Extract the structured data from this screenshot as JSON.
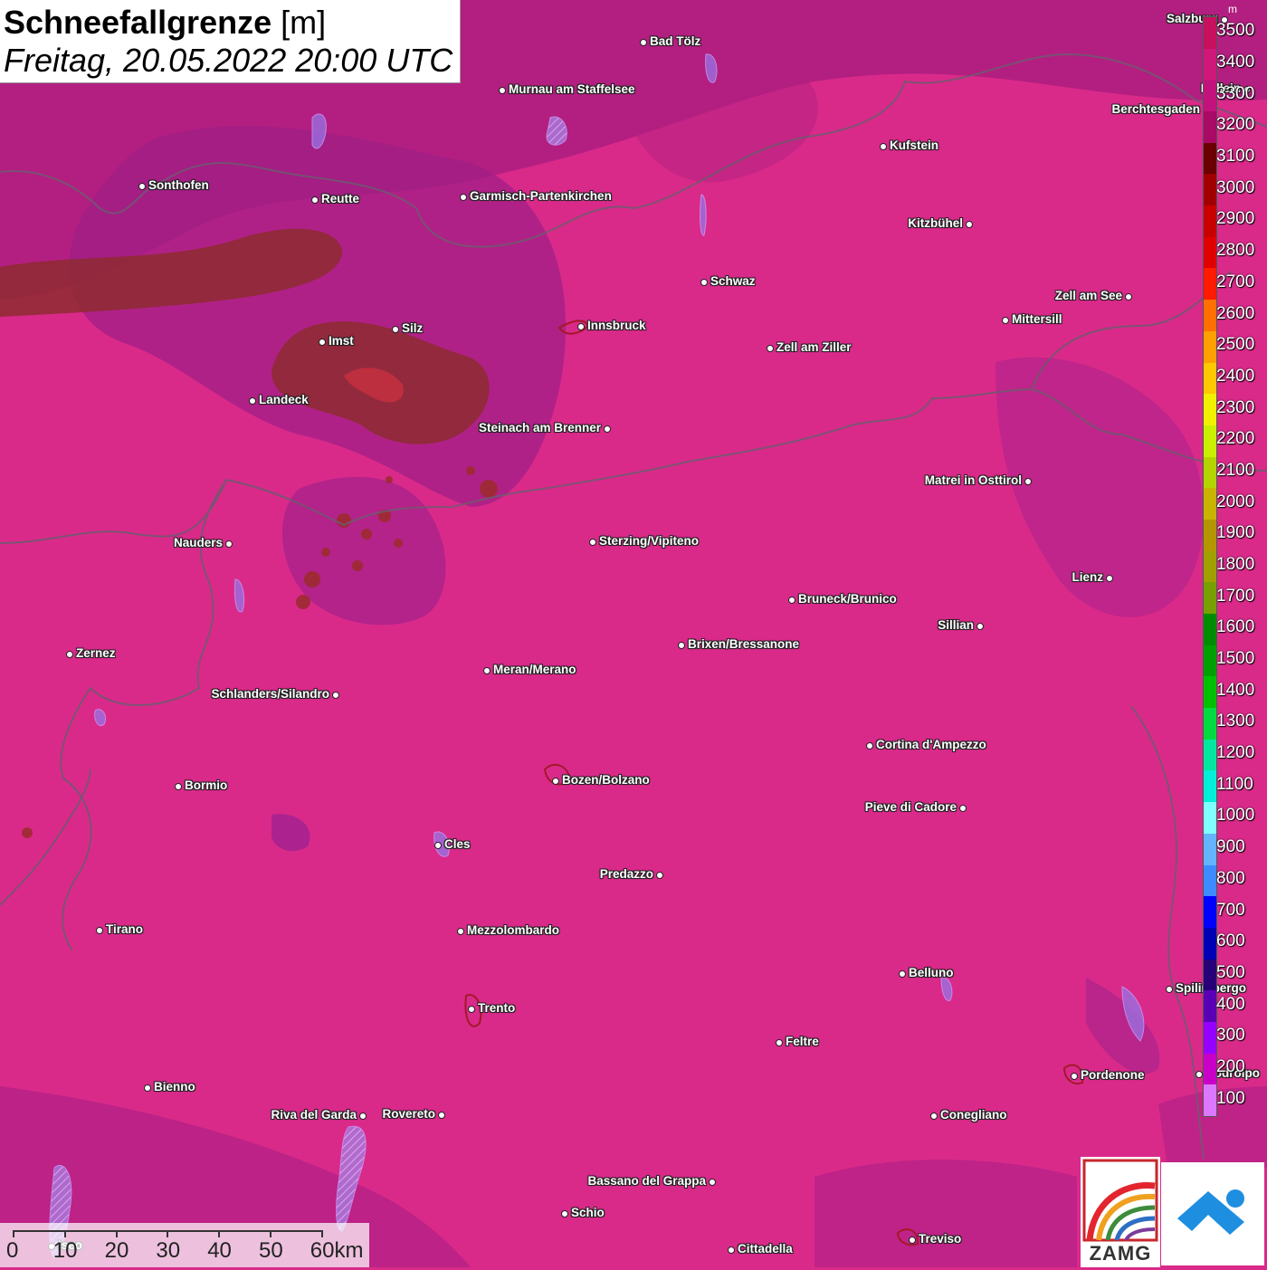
{
  "title": {
    "main": "Schneefallgrenze",
    "unit": "[m]",
    "datetime": "Freitag, 20.05.2022 20:00 UTC"
  },
  "cities": [
    {
      "name": "Bad Tölz",
      "side": "r"
    },
    {
      "name": "Murnau am Staffelsee",
      "side": "r"
    },
    {
      "name": "Salzburg",
      "side": "l"
    },
    {
      "name": "Hallein",
      "side": "l"
    },
    {
      "name": "Berchtesgaden",
      "side": "l"
    },
    {
      "name": "Kufstein",
      "side": "r"
    },
    {
      "name": "Sonthofen",
      "side": "r"
    },
    {
      "name": "Reutte",
      "side": "r"
    },
    {
      "name": "Garmisch-Partenkirchen",
      "side": "r"
    },
    {
      "name": "Kitzbühel",
      "side": "l"
    },
    {
      "name": "Schwaz",
      "side": "r"
    },
    {
      "name": "Zell am See",
      "side": "l"
    },
    {
      "name": "Mittersill",
      "side": "r"
    },
    {
      "name": "Innsbruck",
      "side": "r"
    },
    {
      "name": "Silz",
      "side": "r"
    },
    {
      "name": "Imst",
      "side": "r"
    },
    {
      "name": "Zell am Ziller",
      "side": "r"
    },
    {
      "name": "Landeck",
      "side": "r"
    },
    {
      "name": "Steinach am Brenner",
      "side": "l"
    },
    {
      "name": "Matrei in Osttirol",
      "side": "l"
    },
    {
      "name": "Nauders",
      "side": "l"
    },
    {
      "name": "Sterzing/Vipiteno",
      "side": "r"
    },
    {
      "name": "Lienz",
      "side": "l"
    },
    {
      "name": "Bruneck/Brunico",
      "side": "r"
    },
    {
      "name": "Sillian",
      "side": "l"
    },
    {
      "name": "Zernez",
      "side": "r"
    },
    {
      "name": "Brixen/Bressanone",
      "side": "r"
    },
    {
      "name": "Meran/Merano",
      "side": "r"
    },
    {
      "name": "Schlanders/Silandro",
      "side": "l"
    },
    {
      "name": "Cortina d'Ampezzo",
      "side": "r"
    },
    {
      "name": "Bozen/Bolzano",
      "side": "r"
    },
    {
      "name": "Bormio",
      "side": "r"
    },
    {
      "name": "Pieve di Cadore",
      "side": "l"
    },
    {
      "name": "Cles",
      "side": "r"
    },
    {
      "name": "Predazzo",
      "side": "l"
    },
    {
      "name": "Tirano",
      "side": "r"
    },
    {
      "name": "Mezzolombardo",
      "side": "r"
    },
    {
      "name": "Belluno",
      "side": "r"
    },
    {
      "name": "Spilimbergo",
      "side": "r"
    },
    {
      "name": "Trento",
      "side": "r"
    },
    {
      "name": "Feltre",
      "side": "r"
    },
    {
      "name": "Pordenone",
      "side": "r"
    },
    {
      "name": "Codroipo",
      "side": "r"
    },
    {
      "name": "Bienno",
      "side": "r"
    },
    {
      "name": "Riva del Garda",
      "side": "l"
    },
    {
      "name": "Rovereto",
      "side": "l"
    },
    {
      "name": "Conegliano",
      "side": "r"
    },
    {
      "name": "Bassano del Grappa",
      "side": "l"
    },
    {
      "name": "Schio",
      "side": "r"
    },
    {
      "name": "Iseo",
      "side": "r"
    },
    {
      "name": "Treviso",
      "side": "r"
    },
    {
      "name": "Cittadella",
      "side": "r"
    }
  ],
  "legend": {
    "unit": "m",
    "labels": [
      "3500",
      "3400",
      "3300",
      "3200",
      "3100",
      "3000",
      "2900",
      "2800",
      "2700",
      "2600",
      "2500",
      "2400",
      "2300",
      "2200",
      "2100",
      "2000",
      "1900",
      "1800",
      "1700",
      "1600",
      "1500",
      "1400",
      "1300",
      "1200",
      "1100",
      "1000",
      "900",
      "800",
      "700",
      "600",
      "500",
      "400",
      "300",
      "200",
      "100"
    ],
    "colors": [
      "#c8105e",
      "#d0187a",
      "#c4127c",
      "#a80a66",
      "#6a0000",
      "#a20000",
      "#c80000",
      "#e00000",
      "#ff1a00",
      "#ff7000",
      "#ffa000",
      "#ffc800",
      "#f0f000",
      "#c8f000",
      "#b4d400",
      "#c8b400",
      "#b49600",
      "#a0a000",
      "#78a000",
      "#008c00",
      "#00a000",
      "#00c000",
      "#00dc40",
      "#00e8a0",
      "#00f0d8",
      "#80ffff",
      "#64b4ff",
      "#3c8cff",
      "#0000ff",
      "#0000b4",
      "#280078",
      "#5a00b4",
      "#9600ff",
      "#c800c8",
      "#dc78ff"
    ]
  },
  "scalebar": {
    "labels": [
      "0",
      "10",
      "20",
      "30",
      "40",
      "50",
      "60km"
    ]
  },
  "logos": {
    "zamg": "ZAMG"
  }
}
